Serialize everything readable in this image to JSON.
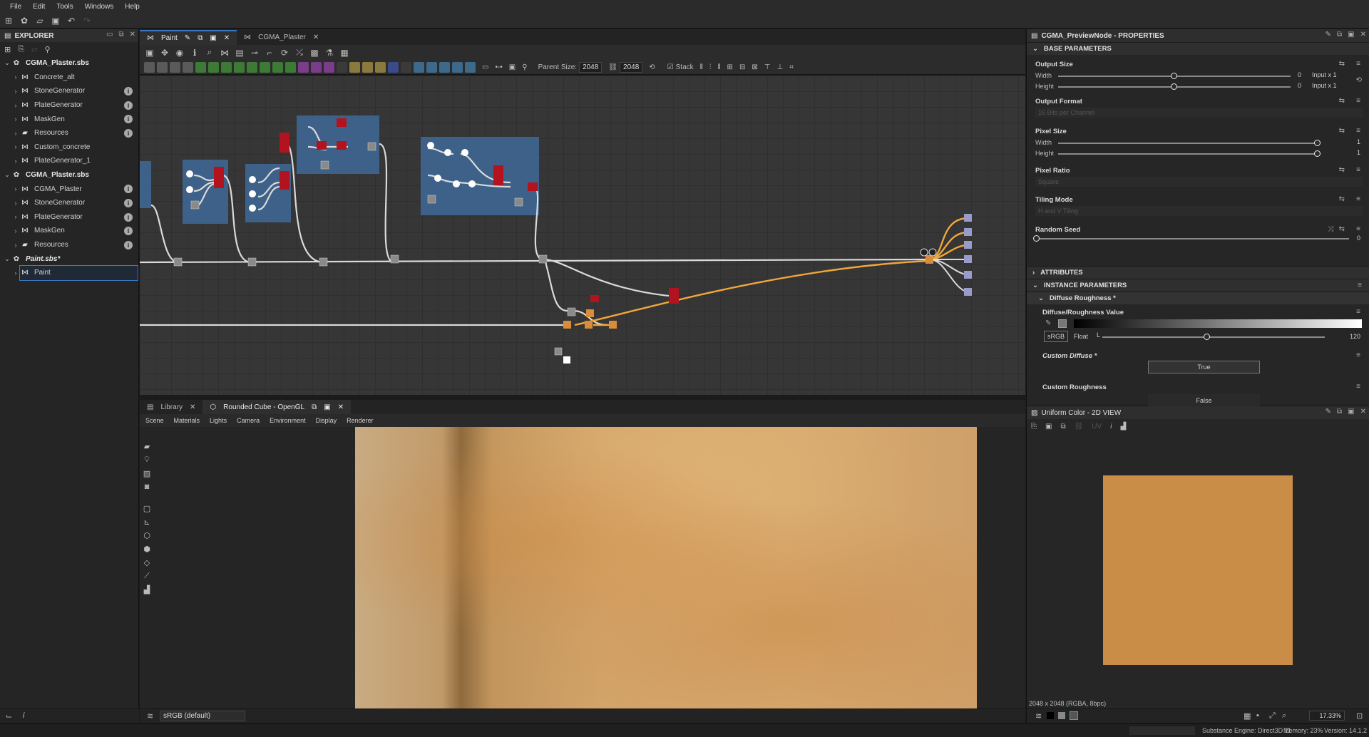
{
  "menu": [
    "File",
    "Edit",
    "Tools",
    "Windows",
    "Help"
  ],
  "explorer": {
    "title": "EXPLORER",
    "items": [
      {
        "label": "CGMA_Plaster.sbs",
        "level": 0,
        "kind": "package",
        "bold": true
      },
      {
        "label": "Concrete_alt",
        "level": 1,
        "kind": "graph",
        "info": false
      },
      {
        "label": "StoneGenerator",
        "level": 1,
        "kind": "graph",
        "info": true
      },
      {
        "label": "PlateGenerator",
        "level": 1,
        "kind": "graph",
        "info": true
      },
      {
        "label": "MaskGen",
        "level": 1,
        "kind": "graph",
        "info": true
      },
      {
        "label": "Resources",
        "level": 1,
        "kind": "folder",
        "info": true
      },
      {
        "label": "Custom_concrete",
        "level": 1,
        "kind": "graph",
        "info": false
      },
      {
        "label": "PlateGenerator_1",
        "level": 1,
        "kind": "graph",
        "info": false
      },
      {
        "label": "CGMA_Plaster.sbs",
        "level": 0,
        "kind": "package",
        "bold": true
      },
      {
        "label": "CGMA_Plaster",
        "level": 1,
        "kind": "graph",
        "info": true
      },
      {
        "label": "StoneGenerator",
        "level": 1,
        "kind": "graph",
        "info": true
      },
      {
        "label": "PlateGenerator",
        "level": 1,
        "kind": "graph",
        "info": true
      },
      {
        "label": "MaskGen",
        "level": 1,
        "kind": "graph",
        "info": true
      },
      {
        "label": "Resources",
        "level": 1,
        "kind": "folder",
        "info": true
      },
      {
        "label": "Paint.sbs*",
        "level": 0,
        "kind": "package",
        "bold": true,
        "italic": true
      },
      {
        "label": "Paint",
        "level": 1,
        "kind": "graph",
        "info": false,
        "selected": true
      }
    ]
  },
  "graph_tabs": [
    {
      "label": "Paint",
      "active": true
    },
    {
      "label": "CGMA_Plaster",
      "active": false
    }
  ],
  "graph_toolbar": {
    "parent_size_label": "Parent Size:",
    "parent_size_value": "2048",
    "size_value": "2048",
    "stack_label": "Stack"
  },
  "viewport": {
    "tabs": [
      {
        "label": "Library"
      },
      {
        "label": "Rounded Cube - OpenGL"
      }
    ],
    "menu": [
      "Scene",
      "Materials",
      "Lights",
      "Camera",
      "Environment",
      "Display",
      "Renderer"
    ],
    "colorspace": "sRGB (default)"
  },
  "properties": {
    "title": "CGMA_PreviewNode - PROPERTIES",
    "base_parameters": "BASE PARAMETERS",
    "output_size": {
      "label": "Output Size",
      "width_label": "Width",
      "height_label": "Height",
      "width_value": "0",
      "height_value": "0",
      "width_suffix": "Input x 1",
      "height_suffix": "Input x 1",
      "width_frac": 0.5,
      "height_frac": 0.5
    },
    "output_format": {
      "label": "Output Format",
      "value": "16 Bits per Channel"
    },
    "pixel_size": {
      "label": "Pixel Size",
      "width_label": "Width",
      "height_label": "Height",
      "width_value": "1",
      "height_value": "1",
      "width_frac": 1.0,
      "height_frac": 1.0
    },
    "pixel_ratio": {
      "label": "Pixel Ratio",
      "value": "Square"
    },
    "tiling_mode": {
      "label": "Tiling Mode",
      "value": "H and V Tiling"
    },
    "random_seed": {
      "label": "Random Seed",
      "value": "0",
      "frac": 0.0
    },
    "attributes": "ATTRIBUTES",
    "instance_parameters": "INSTANCE PARAMETERS",
    "diffuse_roughness_group": "Diffuse Roughness *",
    "diffuse_roughness_value": {
      "label": "Diffuse/Roughness Value",
      "srgb": "sRGB",
      "float": "Float",
      "channel": "L",
      "value": "120",
      "frac": 0.47
    },
    "custom_diffuse": {
      "label": "Custom Diffuse *",
      "value": "True"
    },
    "custom_roughness": {
      "label": "Custom Roughness",
      "value": "False"
    }
  },
  "view2d": {
    "title": "Uniform Color - 2D VIEW",
    "info": "2048 x 2048 (RGBA, 8bpc)",
    "zoom": "17.33%",
    "swatch_color": "#c98d48",
    "uv_label": "UV"
  },
  "status": {
    "engine": "Substance Engine: Direct3D 11",
    "memory": "Memory: 23%",
    "version": "Version: 14.1.2"
  },
  "colors": {
    "accent": "#3b78c4",
    "wire_orange": "#f0a63a",
    "node_red": "#b3131f",
    "frame_blue": "#3d6188"
  }
}
